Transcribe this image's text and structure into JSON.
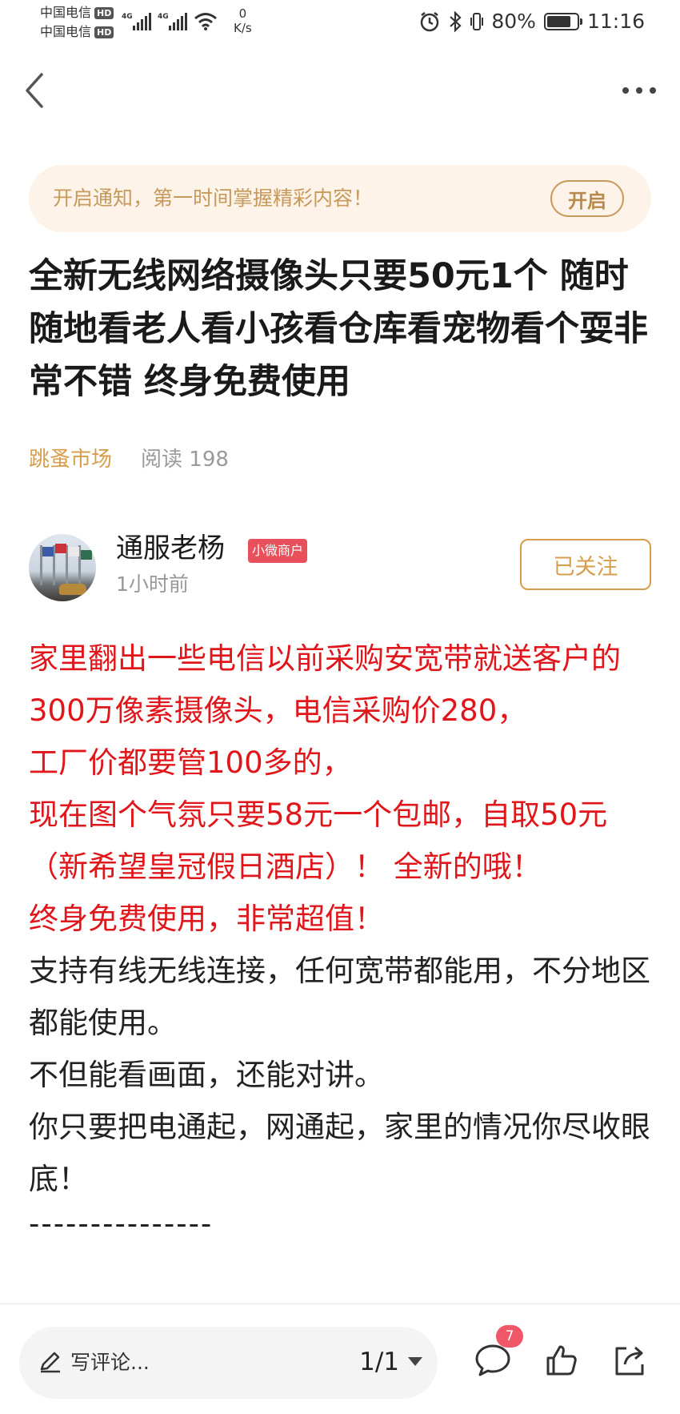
{
  "status_bar": {
    "carrier1": "中国电信",
    "carrier2": "中国电信",
    "hd": "HD",
    "net": "4G",
    "speed_value": "0",
    "speed_unit": "K/s",
    "battery": "80%",
    "battery_level": 0.8,
    "time": "11:16"
  },
  "notice": {
    "text": "开启通知，第一时间掌握精彩内容！",
    "button": "开启"
  },
  "article": {
    "title": "全新无线网络摄像头只要50元1个 随时随地看老人看小孩看仓库看宠物看个耍非常不错 终身免费使用",
    "category": "跳蚤市场",
    "reads": "阅读 198"
  },
  "author": {
    "name": "通服老杨",
    "badge": "小微商户",
    "time": "1小时前",
    "follow": "已关注"
  },
  "content": {
    "red1": "家里翻出一些电信以前采购安宽带就送客户的300万像素摄像头，电信采购价280，",
    "red2": "工厂价都要管100多的，",
    "red3": "现在图个气氛只要58元一个包邮，自取50元（新希望皇冠假日酒店）！ 全新的哦！",
    "red4": "终身免费使用，非常超值！",
    "black1": "支持有线无线连接，任何宽带都能用，不分地区都能使用。",
    "black2": "不但能看画面，还能对讲。",
    "black3": "你只要把电通起，网通起，家里的情况你尽收眼底！",
    "divider": "---------------"
  },
  "bottom": {
    "comment_placeholder": "写评论...",
    "page": "1/1",
    "comment_count": "7"
  },
  "colors": {
    "accent": "#d79d4c",
    "red_text": "#e0161b",
    "badge": "#e8505b",
    "notice_bg": "#fdf3e8"
  },
  "icons": [
    "back-arrow-icon",
    "more-dots-icon",
    "pen-icon",
    "dropdown-triangle-icon",
    "comment-icon",
    "like-thumb-icon",
    "share-icon",
    "signal-icon",
    "wifi-icon",
    "alarm-icon",
    "bluetooth-icon",
    "battery-icon"
  ]
}
